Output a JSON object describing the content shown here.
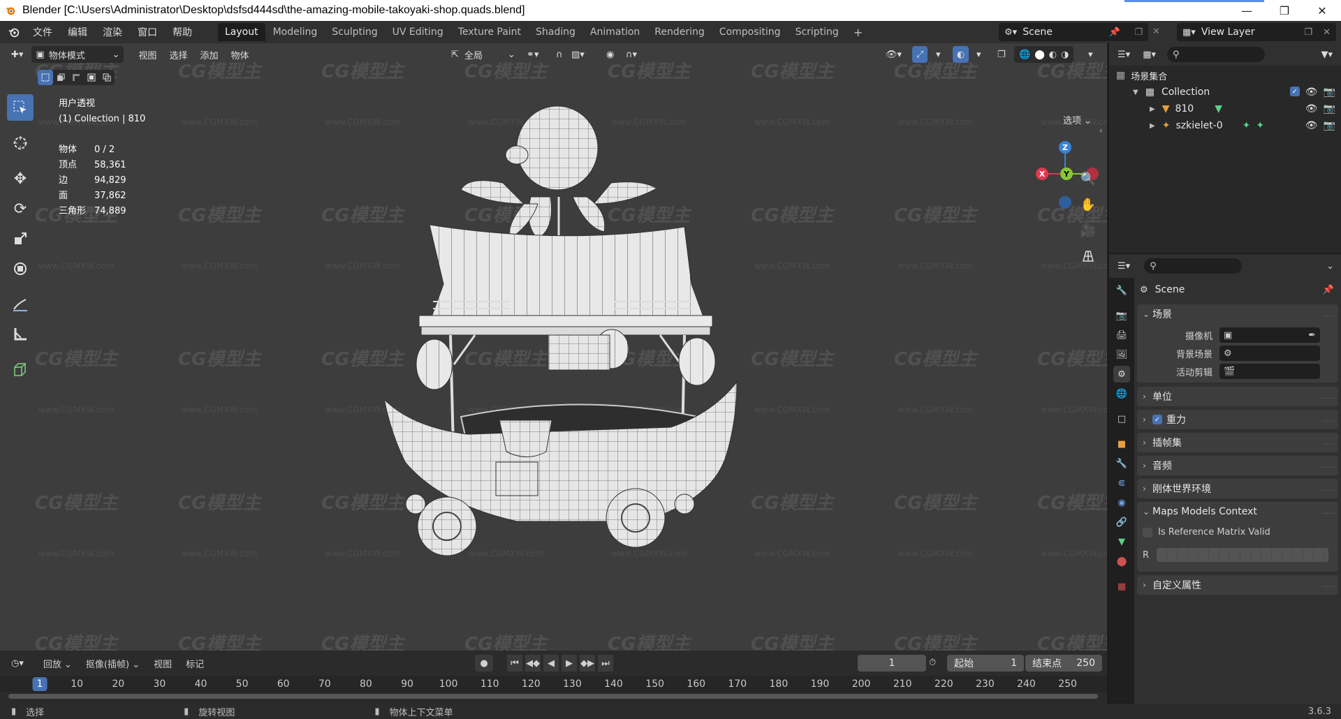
{
  "window": {
    "title": "Blender [C:\\Users\\Administrator\\Desktop\\dsfsd444sd\\the-amazing-mobile-takoyaki-shop.quads.blend]",
    "controls": [
      "minimize-icon",
      "restore-icon",
      "close-icon"
    ]
  },
  "menu": [
    "文件",
    "编辑",
    "渲染",
    "窗口",
    "帮助"
  ],
  "workspaces": {
    "active": "Layout",
    "tabs": [
      "Layout",
      "Modeling",
      "Sculpting",
      "UV Editing",
      "Texture Paint",
      "Shading",
      "Animation",
      "Rendering",
      "Compositing",
      "Scripting"
    ],
    "add": "+"
  },
  "scene_selector": {
    "label": "Scene"
  },
  "view_layer_selector": {
    "label": "View Layer"
  },
  "viewport": {
    "mode": "物体模式",
    "menu": [
      "视图",
      "选择",
      "添加",
      "物体"
    ],
    "transform_orientation": "全局",
    "options_label": "选项",
    "view_name": "用户透视",
    "collection_info": "(1) Collection | 810",
    "stats": [
      {
        "key": "物体",
        "value": "0 / 2"
      },
      {
        "key": "顶点",
        "value": "58,361"
      },
      {
        "key": "边",
        "value": "94,829"
      },
      {
        "key": "面",
        "value": "37,862"
      },
      {
        "key": "三角形",
        "value": "74,889"
      }
    ],
    "gizmo": {
      "z": "Z",
      "y": "Y",
      "x": "X"
    },
    "tools": [
      "select-box-icon",
      "cursor-icon",
      "move-icon",
      "rotate-icon",
      "scale-icon",
      "transform-icon",
      "annotate-icon",
      "measure-icon",
      "add-cube-icon"
    ],
    "watermark": "CG模型主",
    "watermark_url": "www.CGMXW.com"
  },
  "timeline": {
    "menu": [
      "回放",
      "抠像(插帧)",
      "视图",
      "标记"
    ],
    "current_frame": "1",
    "start_label": "起始",
    "start_value": "1",
    "end_label": "结束点",
    "end_value": "250",
    "ruler": [
      "1",
      "10",
      "20",
      "30",
      "40",
      "50",
      "60",
      "70",
      "80",
      "90",
      "100",
      "110",
      "120",
      "130",
      "140",
      "150",
      "160",
      "170",
      "180",
      "190",
      "200",
      "210",
      "220",
      "230",
      "240",
      "250"
    ]
  },
  "statusbar": {
    "left": "选择",
    "mid": "旋转视图",
    "right": "物体上下文菜单",
    "version": "3.6.3"
  },
  "outliner": {
    "root": "场景集合",
    "rows": [
      {
        "name": "Collection",
        "type": "collection"
      },
      {
        "name": "810",
        "type": "mesh"
      },
      {
        "name": "szkielet-0",
        "type": "armature"
      }
    ]
  },
  "properties": {
    "context": "Scene",
    "panels": {
      "scene": "场景",
      "camera_label": "摄像机",
      "background_label": "背景场景",
      "clip_label": "活动剪辑",
      "units": "单位",
      "gravity": "重力",
      "keying_sets": "插帧集",
      "audio": "音频",
      "rigid_body": "刚体世界环境",
      "maps_context": "Maps Models Context",
      "ref_matrix": "Is Reference Matrix Valid",
      "r_label": "R",
      "custom_props": "自定义属性"
    }
  },
  "colors": {
    "accent": "#4772b3",
    "viewport_bg": "#3d3d3d",
    "panel_bg": "#303030",
    "axis_x": "#e0384f",
    "axis_y": "#8bc634",
    "axis_z": "#3b82d6"
  }
}
